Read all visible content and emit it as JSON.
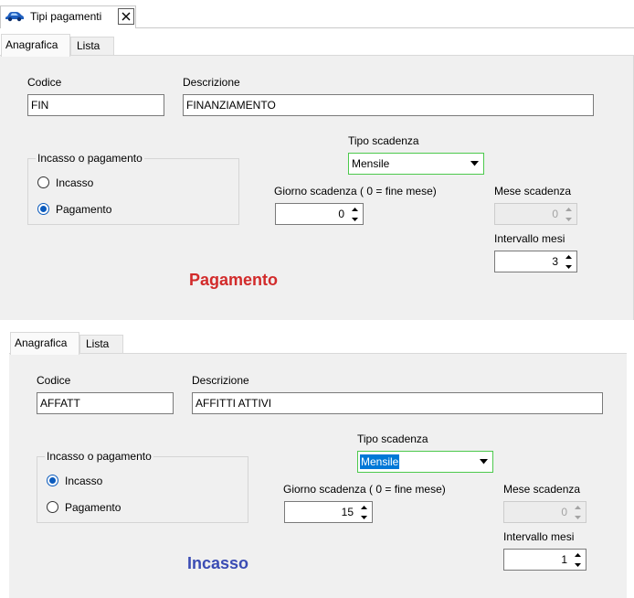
{
  "window_tab": {
    "title": "Tipi pagamenti",
    "icon": "car-icon",
    "close_icon": "close-icon"
  },
  "colors": {
    "panel_background": "#f0f0f0",
    "focus_border": "#4cc94c",
    "selection": "#0078d7",
    "radio_checked": "#0b5bbd"
  },
  "panels": [
    {
      "tabs": [
        {
          "label": "Anagrafica",
          "selected": true
        },
        {
          "label": "Lista",
          "selected": false
        }
      ],
      "codice": {
        "label": "Codice",
        "value": "FIN"
      },
      "descrizione": {
        "label": "Descrizione",
        "value": "FINANZIAMENTO"
      },
      "incasso_pagamento": {
        "label": "Incasso o pagamento",
        "options": [
          {
            "label": "Incasso",
            "checked": false
          },
          {
            "label": "Pagamento",
            "checked": true
          }
        ]
      },
      "tipo_scadenza": {
        "label": "Tipo scadenza",
        "value": "Mensile",
        "value_selected": false
      },
      "giorno_scadenza": {
        "label": "Giorno scadenza ( 0 = fine mese)",
        "value": "0",
        "disabled": false
      },
      "mese_scadenza": {
        "label": "Mese scadenza",
        "value": "0",
        "disabled": true
      },
      "intervallo_mesi": {
        "label": "Intervallo mesi",
        "value": "3",
        "disabled": false
      },
      "caption": {
        "text": "Pagamento",
        "color": "#d22b2b"
      }
    },
    {
      "tabs": [
        {
          "label": "Anagrafica",
          "selected": true
        },
        {
          "label": "Lista",
          "selected": false
        }
      ],
      "codice": {
        "label": "Codice",
        "value": "AFFATT"
      },
      "descrizione": {
        "label": "Descrizione",
        "value": "AFFITTI ATTIVI"
      },
      "incasso_pagamento": {
        "label": "Incasso o pagamento",
        "options": [
          {
            "label": "Incasso",
            "checked": true
          },
          {
            "label": "Pagamento",
            "checked": false
          }
        ]
      },
      "tipo_scadenza": {
        "label": "Tipo scadenza",
        "value": "Mensile",
        "value_selected": true
      },
      "giorno_scadenza": {
        "label": "Giorno scadenza ( 0 = fine mese)",
        "value": "15",
        "disabled": false
      },
      "mese_scadenza": {
        "label": "Mese scadenza",
        "value": "0",
        "disabled": true
      },
      "intervallo_mesi": {
        "label": "Intervallo mesi",
        "value": "1",
        "disabled": false
      },
      "caption": {
        "text": "Incasso",
        "color": "#3a4cb4"
      }
    }
  ]
}
